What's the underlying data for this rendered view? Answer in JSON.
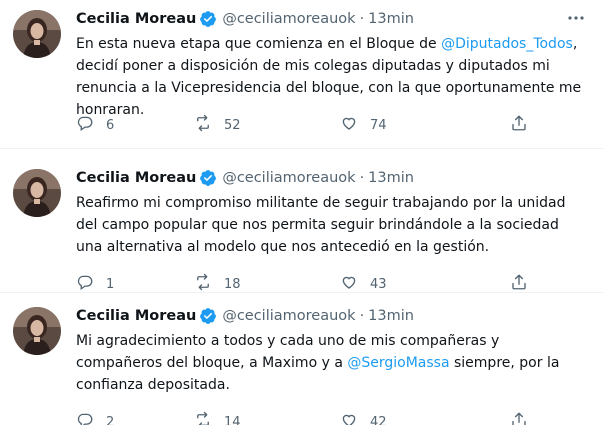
{
  "author": {
    "name": "Cecilia Moreau",
    "handle": "@ceciliamoreauok",
    "separator": "·"
  },
  "colors": {
    "text": "#0f1419",
    "secondary": "#536471",
    "link": "#1d9bf0",
    "divider": "#eff3f4"
  },
  "tweets": [
    {
      "time": "13min",
      "text_before": "En esta nueva etapa que comienza en el Bloque de ",
      "mention": "@Diputados_Todos",
      "text_after": ", decidí poner a disposición de mis colegas diputadas y diputados mi renuncia a la Vicepresidencia del bloque, con la que oportunamente me honraran.",
      "replies": "6",
      "retweets": "52",
      "likes": "74"
    },
    {
      "time": "13min",
      "text_before": "Reafirmo mi compromiso militante de seguir trabajando por la unidad del campo popular que nos permita seguir brindándole a la sociedad una alternativa al modelo que nos antecedió en la gestión.",
      "mention": "",
      "text_after": "",
      "replies": "1",
      "retweets": "18",
      "likes": "43"
    },
    {
      "time": "13min",
      "text_before": "Mi agradecimiento a todos y cada uno de mis compañeras y compañeros del bloque, a Maximo y a ",
      "mention": "@SergioMassa",
      "text_after": " siempre, por la confianza depositada.",
      "replies": "2",
      "retweets": "14",
      "likes": "42"
    }
  ],
  "icons": {
    "reply": "reply-icon",
    "retweet": "retweet-icon",
    "like": "heart-icon",
    "share": "share-icon",
    "verified": "verified-badge-icon",
    "more": "more-options-icon"
  }
}
